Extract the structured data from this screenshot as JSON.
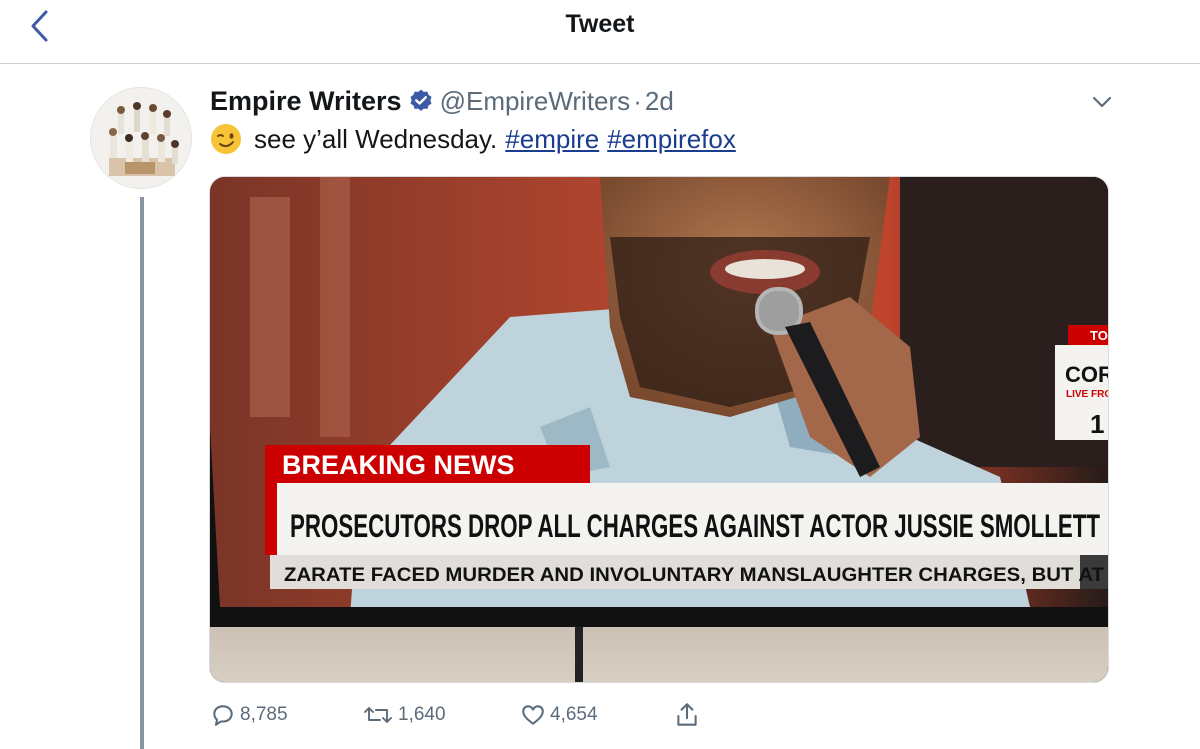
{
  "nav": {
    "title": "Tweet",
    "back_icon": "chevron-left-icon"
  },
  "tweet": {
    "display_name": "Empire Writers",
    "handle": "@EmpireWriters",
    "separator": "·",
    "time": "2d",
    "text": "see y’all Wednesday.",
    "hashtags": [
      "#empire",
      "#empirefox"
    ],
    "emoji": "winking-face"
  },
  "media": {
    "banner_label": "BREAKING NEWS",
    "headline": "PROSECUTORS DROP ALL CHARGES AGAINST ACTOR JUSSIE SMOLLETT",
    "ticker": "ZARATE FACED MURDER AND INVOLUNTARY MANSLAUGHTER CHARGES, BUT AT",
    "corner_top": "TO",
    "corner_name": "CORY",
    "corner_sub": "LIVE FROM",
    "corner_num": "1"
  },
  "actions": {
    "replies": "8,785",
    "retweets": "1,640",
    "likes": "4,654"
  },
  "colors": {
    "accent": "#1b3d8f",
    "muted": "#5b6b7a",
    "verified": "#3b5ba5",
    "news_red": "#cc0000"
  }
}
